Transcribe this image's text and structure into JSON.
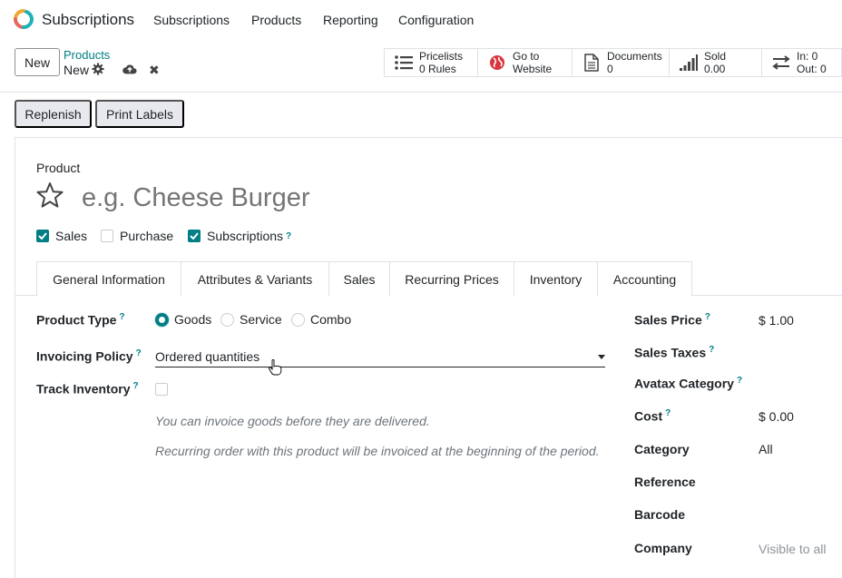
{
  "app": {
    "name": "Subscriptions"
  },
  "nav": {
    "items": [
      "Subscriptions",
      "Products",
      "Reporting",
      "Configuration"
    ]
  },
  "control_panel": {
    "new_label": "New",
    "breadcrumb_parent": "Products",
    "breadcrumb_current": "New",
    "stats": [
      {
        "line1": "Pricelists",
        "line2": "0 Rules",
        "icon": "list-icon"
      },
      {
        "line1": "Go to",
        "line2": "Website",
        "icon": "globe-icon"
      },
      {
        "line1": "Documents",
        "line2": "0",
        "icon": "document-icon"
      },
      {
        "line1": "Sold",
        "line2": "0.00",
        "icon": "signal-icon"
      },
      {
        "line1": "In: 0",
        "line2": "Out: 0",
        "icon": "exchange-icon"
      }
    ]
  },
  "actions": {
    "replenish": "Replenish",
    "print_labels": "Print Labels"
  },
  "form": {
    "product_label": "Product",
    "name_placeholder": "e.g. Cheese Burger",
    "checkboxes": [
      {
        "label": "Sales",
        "checked": true
      },
      {
        "label": "Purchase",
        "checked": false
      },
      {
        "label": "Subscriptions",
        "checked": true,
        "help": "?"
      }
    ],
    "tabs": [
      "General Information",
      "Attributes & Variants",
      "Sales",
      "Recurring Prices",
      "Inventory",
      "Accounting"
    ],
    "active_tab": "General Information",
    "left": {
      "product_type_label": "Product Type",
      "product_type_options": [
        "Goods",
        "Service",
        "Combo"
      ],
      "product_type_selected": "Goods",
      "invoicing_policy_label": "Invoicing Policy",
      "invoicing_policy_value": "Ordered quantities",
      "track_inventory_label": "Track Inventory",
      "note1": "You can invoice goods before they are delivered.",
      "note2": "Recurring order with this product will be invoiced at the beginning of the period.",
      "help": "?"
    },
    "right": {
      "sales_price_label": "Sales Price",
      "sales_price_value": "$ 1.00",
      "sales_taxes_label": "Sales Taxes",
      "avatax_label": "Avatax Category",
      "cost_label": "Cost",
      "cost_value": "$ 0.00",
      "category_label": "Category",
      "category_value": "All",
      "reference_label": "Reference",
      "barcode_label": "Barcode",
      "company_label": "Company",
      "company_value": "Visible to all"
    }
  },
  "colors": {
    "accent": "#017e84",
    "logo_orange": "#f0a830",
    "logo_teal": "#1fb1b6",
    "globe_red": "#d9363e"
  }
}
